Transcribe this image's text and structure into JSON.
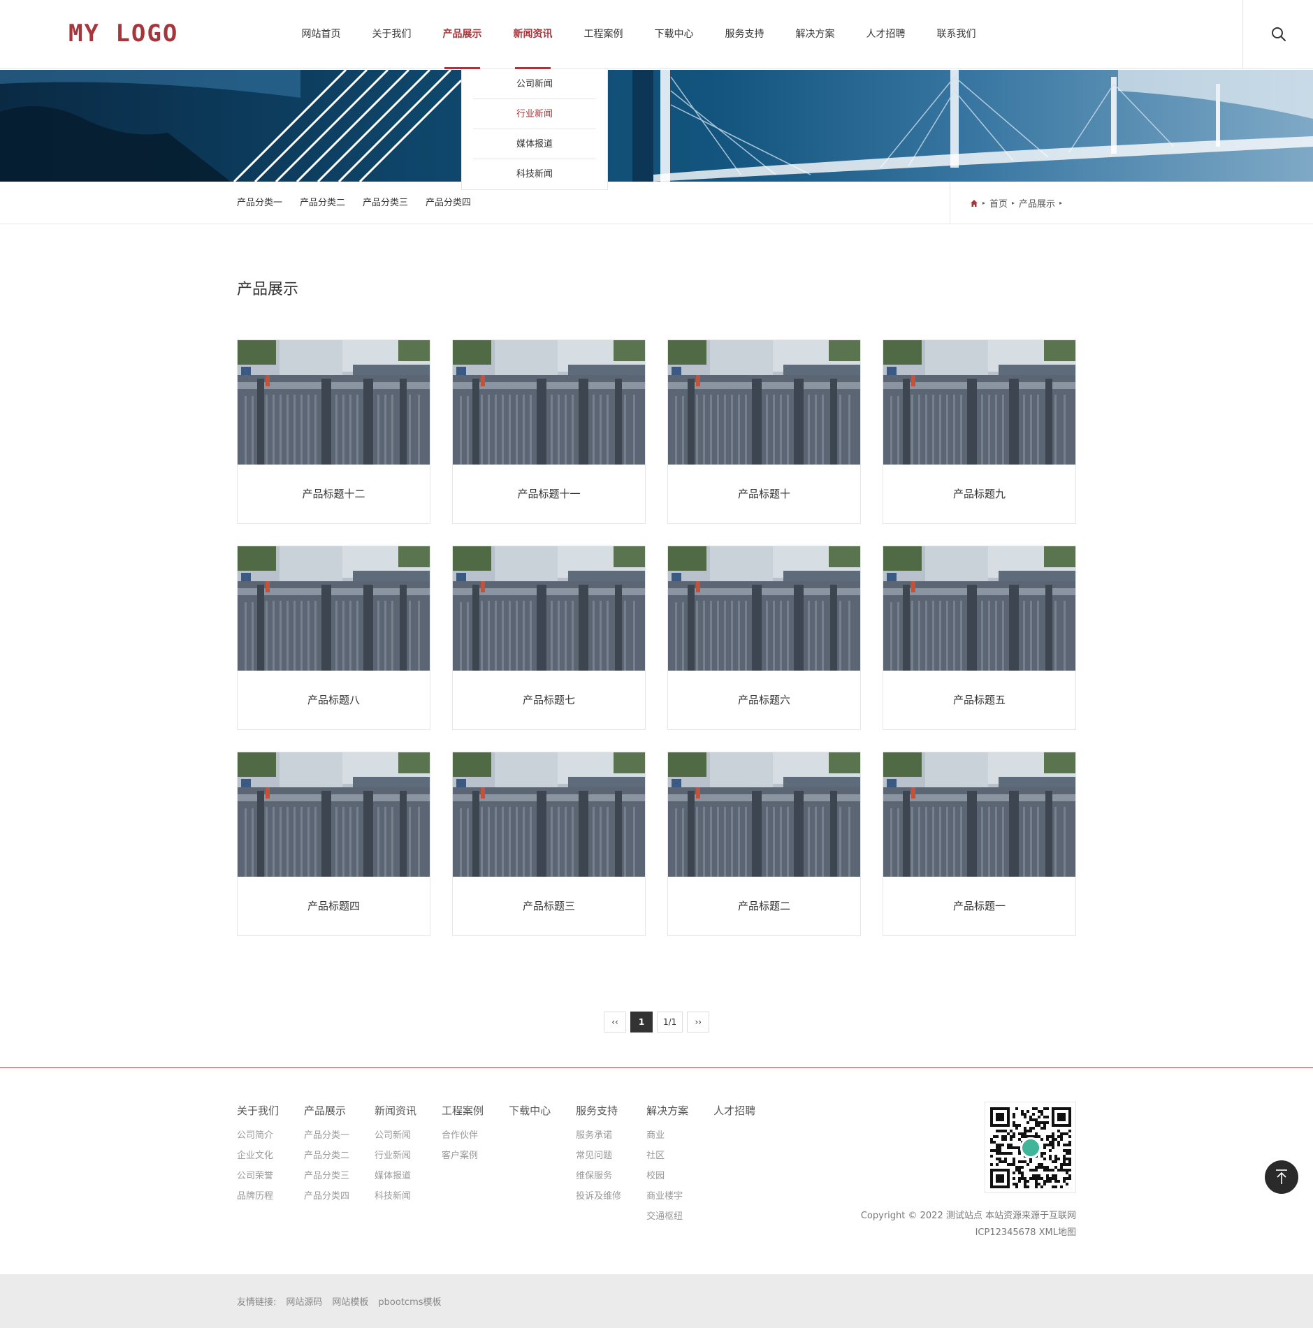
{
  "header": {
    "logo": "MY LOGO",
    "nav": [
      {
        "label": "网站首页"
      },
      {
        "label": "关于我们"
      },
      {
        "label": "产品展示"
      },
      {
        "label": "新闻资讯"
      },
      {
        "label": "工程案例"
      },
      {
        "label": "下载中心"
      },
      {
        "label": "服务支持"
      },
      {
        "label": "解决方案"
      },
      {
        "label": "人才招聘"
      },
      {
        "label": "联系我们"
      }
    ]
  },
  "dropdown": {
    "items": [
      {
        "label": "公司新闻"
      },
      {
        "label": "行业新闻"
      },
      {
        "label": "媒体报道"
      },
      {
        "label": "科技新闻"
      }
    ]
  },
  "subnav": {
    "categories": [
      {
        "label": "产品分类一"
      },
      {
        "label": "产品分类二"
      },
      {
        "label": "产品分类三"
      },
      {
        "label": "产品分类四"
      }
    ],
    "breadcrumb": [
      {
        "label": "首页"
      },
      {
        "label": "产品展示"
      }
    ]
  },
  "main": {
    "title": "产品展示",
    "products": [
      {
        "title": "产品标题十二"
      },
      {
        "title": "产品标题十一"
      },
      {
        "title": "产品标题十"
      },
      {
        "title": "产品标题九"
      },
      {
        "title": "产品标题八"
      },
      {
        "title": "产品标题七"
      },
      {
        "title": "产品标题六"
      },
      {
        "title": "产品标题五"
      },
      {
        "title": "产品标题四"
      },
      {
        "title": "产品标题三"
      },
      {
        "title": "产品标题二"
      },
      {
        "title": "产品标题一"
      }
    ]
  },
  "pager": {
    "prev": "‹‹",
    "current": "1",
    "pages": "1/1",
    "next": "››"
  },
  "footer": {
    "columns": [
      {
        "title": "关于我们",
        "links": [
          "公司简介",
          "企业文化",
          "公司荣誉",
          "品牌历程"
        ]
      },
      {
        "title": "产品展示",
        "links": [
          "产品分类一",
          "产品分类二",
          "产品分类三",
          "产品分类四"
        ]
      },
      {
        "title": "新闻资讯",
        "links": [
          "公司新闻",
          "行业新闻",
          "媒体报道",
          "科技新闻"
        ]
      },
      {
        "title": "工程案例",
        "links": [
          "合作伙伴",
          "客户案例"
        ]
      },
      {
        "title": "下载中心",
        "links": []
      },
      {
        "title": "服务支持",
        "links": [
          "服务承诺",
          "常见问题",
          "维保服务",
          "投诉及维修"
        ]
      },
      {
        "title": "解决方案",
        "links": [
          "商业",
          "社区",
          "校园",
          "商业楼宇",
          "交通枢纽"
        ]
      },
      {
        "title": "人才招聘",
        "links": []
      }
    ],
    "copyright_line1": "Copyright © 2022 测试站点 本站资源来源于互联网",
    "copyright_line2": "ICP12345678 XML地图"
  },
  "friend_links": {
    "label": "友情链接:",
    "links": [
      "网站源码",
      "网站模板",
      "pbootcms模板"
    ]
  },
  "colors": {
    "brand": "#a5373c",
    "border": "#e6e6e6",
    "footer_bar": "#ebebeb"
  },
  "icons": {
    "search": "search-icon",
    "home": "home-icon",
    "back_top": "arrow-up-icon",
    "qr": "qr-code-icon"
  }
}
